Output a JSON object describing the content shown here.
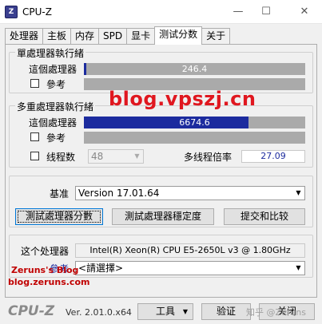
{
  "window": {
    "title": "CPU-Z",
    "icon_text": "Z",
    "minimize": "—",
    "maximize": "☐",
    "close": "✕"
  },
  "tabs": [
    {
      "label": "处理器"
    },
    {
      "label": "主板"
    },
    {
      "label": "内存"
    },
    {
      "label": "SPD"
    },
    {
      "label": "显卡"
    },
    {
      "label": "测试分数"
    },
    {
      "label": "关于"
    }
  ],
  "single": {
    "legend": "單處理器執行緒",
    "this_label": "這個處理器",
    "this_value": "246.4",
    "this_fraction": 0.01,
    "ref_label": "參考"
  },
  "multi": {
    "legend": "多重處理器執行緒",
    "this_label": "這個處理器",
    "this_value": "6674.6",
    "this_fraction": 0.745,
    "ref_label": "參考",
    "threads_label": "线程数",
    "threads_value": "48",
    "ratio_label": "多线程倍率",
    "ratio_value": "27.09"
  },
  "bench": {
    "label": "基准",
    "version": "Version 17.01.64",
    "btn_test": "測試處理器分數",
    "btn_stress": "測試處理器穩定度",
    "btn_submit": "提交和比较"
  },
  "cpu": {
    "label": "这个处理器",
    "name": "Intel(R) Xeon(R) CPU E5-2650L v3 @ 1.80GHz",
    "ref_label": "參考",
    "ref_select": "<請選擇>"
  },
  "footer": {
    "brand": "CPU-Z",
    "version": "Ver. 2.01.0.x64",
    "tools": "工具",
    "validate": "验证",
    "close": "关闭"
  },
  "watermarks": {
    "main": "blog.vpszj.cn",
    "blog": "Zeruns's Blog",
    "site": "blog.zeruns.com",
    "zhihu": "知乎 @Zeruns"
  },
  "colors": {
    "bar_fill": "#1c2b9e",
    "bar_bg": "#aaaaaa",
    "watermark": "#e0171f"
  }
}
